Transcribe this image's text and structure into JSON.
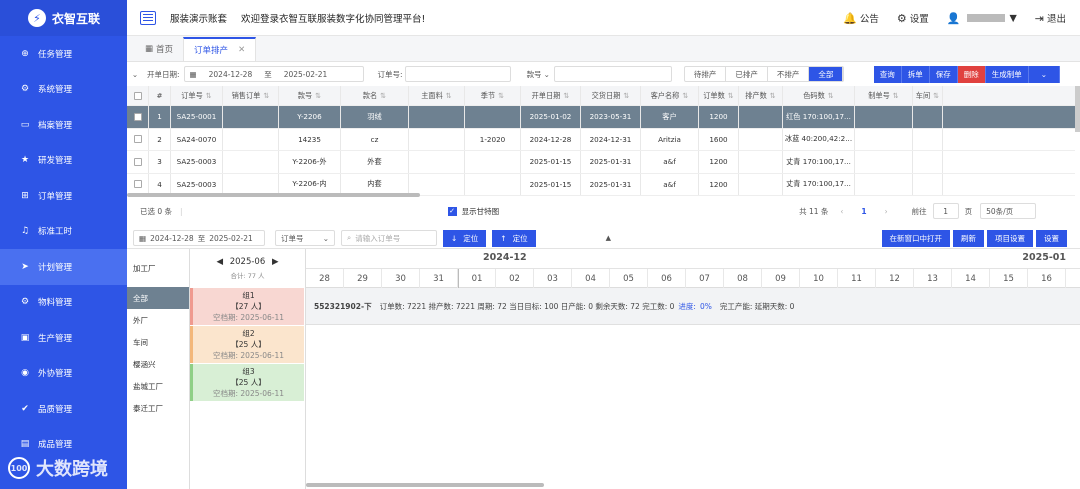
{
  "sidebar": {
    "brand": "衣智互联",
    "items": [
      {
        "label": "任务管理",
        "icon": "plus-circle-icon"
      },
      {
        "label": "系统管理",
        "icon": "gear-icon"
      },
      {
        "label": "档案管理",
        "icon": "monitor-icon"
      },
      {
        "label": "研发管理",
        "icon": "star-icon"
      },
      {
        "label": "订单管理",
        "icon": "cart-icon"
      },
      {
        "label": "标准工时",
        "icon": "bell-icon"
      },
      {
        "label": "计划管理",
        "icon": "send-icon"
      },
      {
        "label": "物料管理",
        "icon": "gear-icon"
      },
      {
        "label": "生产管理",
        "icon": "factory-icon"
      },
      {
        "label": "外协管理",
        "icon": "camera-icon"
      },
      {
        "label": "品质管理",
        "icon": "check-circle-icon"
      },
      {
        "label": "成品管理",
        "icon": "box-icon"
      }
    ],
    "active_index": 6
  },
  "watermark": "大数跨境",
  "header": {
    "account_name": "服装演示账套",
    "welcome": "欢迎登录衣智互联服装数字化协同管理平台!",
    "notice": "公告",
    "settings": "设置",
    "logout": "退出"
  },
  "tabs": [
    {
      "label": "首页",
      "active": false
    },
    {
      "label": "订单排产",
      "active": true
    }
  ],
  "filters": {
    "date_label": "开单日期:",
    "date_from": "2024-12-28",
    "date_sep": "至",
    "date_to": "2025-02-21",
    "order_label": "订单号:",
    "style_label": "款号",
    "segments": [
      "待排产",
      "已排产",
      "不排产",
      "全部"
    ]
  },
  "actions": [
    "查询",
    "拆单",
    "保存",
    "删除",
    "生成制单"
  ],
  "table": {
    "headers": [
      "#",
      "订单号",
      "销售订单",
      "款号",
      "款名",
      "主面料",
      "季节",
      "开单日期",
      "交货日期",
      "客户名称",
      "订单数",
      "排产数",
      "色码数",
      "制单号",
      "车间"
    ],
    "rows": [
      [
        "1",
        "SA25-0001",
        "",
        "Y-2206",
        "羽绒",
        "",
        "",
        "2025-01-02",
        "2023-05-31",
        "客户",
        "1200",
        "",
        "红色 170:100,17...",
        "",
        ""
      ],
      [
        "2",
        "SA24-0070",
        "",
        "14235",
        "cz",
        "",
        "1-2020",
        "2024-12-28",
        "2024-12-31",
        "Aritzia",
        "1600",
        "",
        "冰蓝 40:200,42:2...",
        "",
        ""
      ],
      [
        "3",
        "SA25-0003",
        "",
        "Y-2206-外",
        "外套",
        "",
        "",
        "2025-01-15",
        "2025-01-31",
        "a&f",
        "1200",
        "",
        "丈青 170:100,17...",
        "",
        ""
      ],
      [
        "4",
        "SA25-0003",
        "",
        "Y-2206-内",
        "内套",
        "",
        "",
        "2025-01-15",
        "2025-01-31",
        "a&f",
        "1200",
        "",
        "丈青 170:100,17...",
        "",
        ""
      ]
    ]
  },
  "pager": {
    "selected": "已选 0 条",
    "gantt_toggle": "显示甘特图",
    "total": "共 11 条",
    "current": "1",
    "goto": "前往",
    "goto_value": "1",
    "page_unit": "页",
    "page_size": "50条/页"
  },
  "gantt_toolbar": {
    "date_from": "2024-12-28",
    "date_sep": "至",
    "date_to": "2025-02-21",
    "order_select": "订单号",
    "order_placeholder": "请输入订单号",
    "locate_down": "定位",
    "locate_up": "定位",
    "new_window": "在新窗口中打开",
    "refresh": "刷新",
    "project_settings": "项目设置",
    "settings": "设置"
  },
  "gantt": {
    "factories": [
      "加工厂",
      "全部",
      "外厂",
      "车间",
      "樱涵兴",
      "盐城工厂",
      "泰迁工厂"
    ],
    "month_nav": "2025-06",
    "total_label": "合计: 77 人",
    "lines": [
      {
        "name": "组1",
        "people": "【27 人】",
        "idle": "空档期: 2025-06-11",
        "color": "#f8d7d2",
        "edge": "#ef9a8f"
      },
      {
        "name": "组2",
        "people": "【25 人】",
        "idle": "空档期: 2025-06-11",
        "color": "#fbe5cd",
        "edge": "#f3b77a"
      },
      {
        "name": "组3",
        "people": "【25 人】",
        "idle": "空档期: 2025-06-11",
        "color": "#d8efd5",
        "edge": "#8fcf86"
      }
    ],
    "months": [
      "2024-12",
      "2025-01"
    ],
    "days": [
      "28",
      "29",
      "30",
      "31",
      "01",
      "02",
      "03",
      "04",
      "05",
      "06",
      "07",
      "08",
      "09",
      "10",
      "11",
      "12",
      "13",
      "14",
      "15",
      "16"
    ],
    "row": {
      "order": "552321902-下",
      "info": "订单数: 7221  排产数: 7221  周期: 72  当日目标: 100  日产能: 0  剩余天数: 72  完工数: 0",
      "progress_label": "进度:",
      "progress": "0%",
      "tail": "完工产能:    延期天数: 0"
    }
  }
}
